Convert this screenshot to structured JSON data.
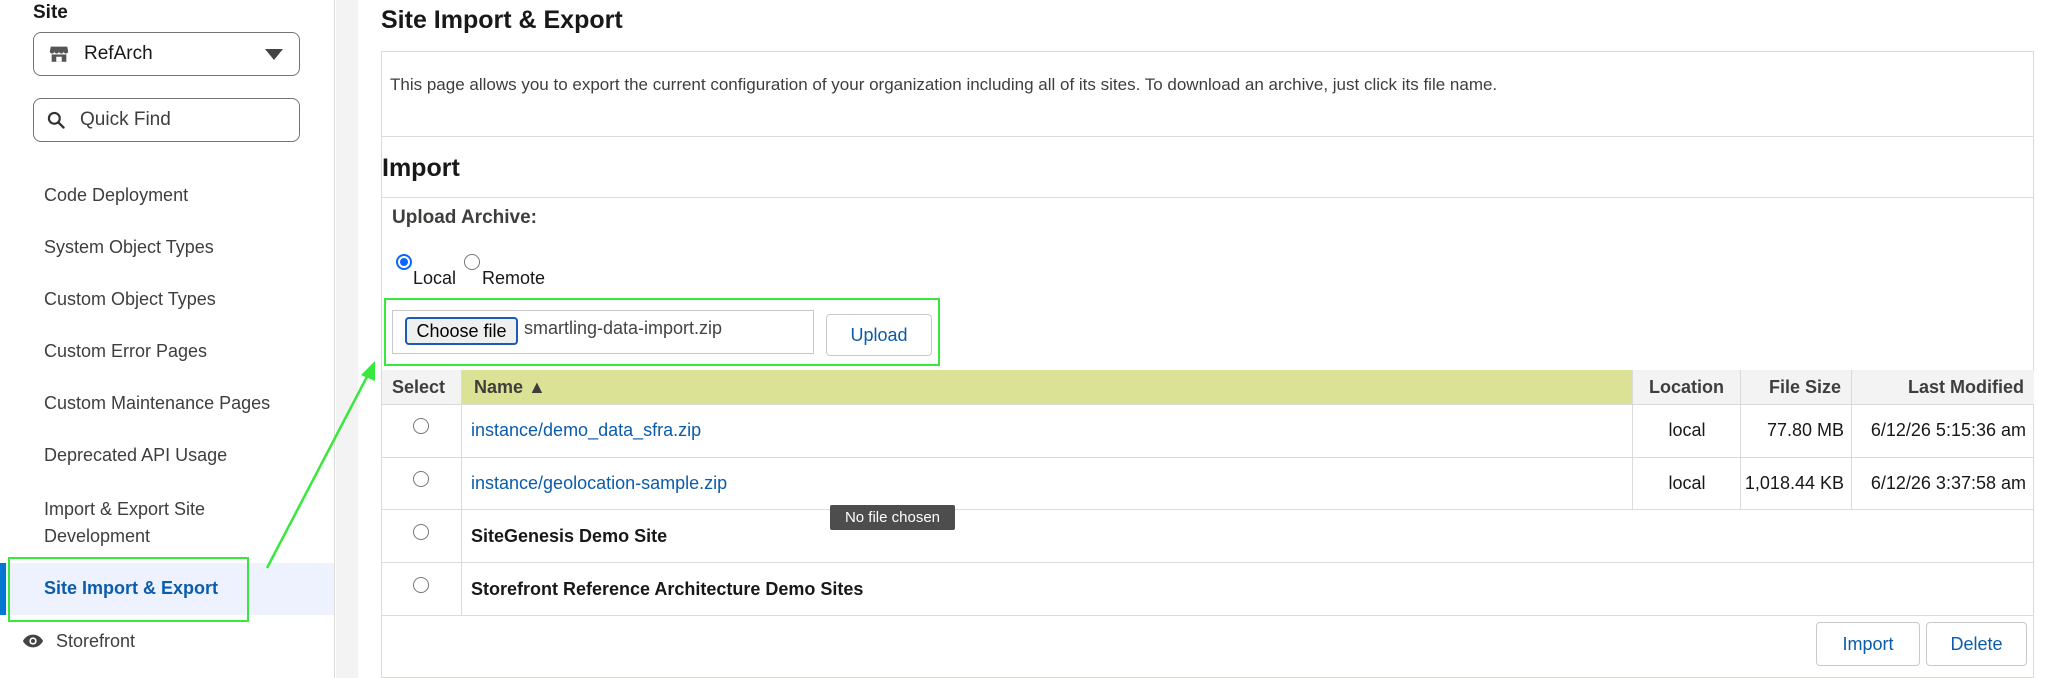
{
  "sidebar": {
    "site_label": "Site",
    "site_select": {
      "value": "RefArch",
      "icon": "store-icon"
    },
    "quick_find": {
      "placeholder": "Quick Find",
      "icon": "search-icon"
    },
    "items": [
      {
        "label": "Code Deployment"
      },
      {
        "label": "System Object Types"
      },
      {
        "label": "Custom Object Types"
      },
      {
        "label": "Custom Error Pages"
      },
      {
        "label": "Custom Maintenance Pages"
      },
      {
        "label": "Deprecated API Usage"
      },
      {
        "label": "Import & Export Site Development"
      },
      {
        "label": "Site Import & Export",
        "active": true
      }
    ],
    "storefront": {
      "label": "Storefront",
      "icon": "eye-icon"
    }
  },
  "main": {
    "title": "Site Import & Export",
    "intro": "This page allows you to export the current configuration of your organization including all of its sites. To download an archive, just click its file name.",
    "import_heading": "Import",
    "upload_label": "Upload Archive:",
    "radio_local": "Local",
    "radio_remote": "Remote",
    "choose_file": "Choose file",
    "file_name": "smartling-data-import.zip",
    "upload_button": "Upload",
    "tooltip": "No file chosen",
    "table": {
      "headers": {
        "select": "Select",
        "name": "Name ▲",
        "location": "Location",
        "size": "File Size",
        "modified": "Last Modified"
      },
      "rows": [
        {
          "name": "instance/demo_data_sfra.zip",
          "location": "local",
          "size": "77.80 MB",
          "modified": "6/12/26 5:15:36 am"
        },
        {
          "name": "instance/geolocation-sample.zip",
          "location": "local",
          "size": "1,018.44 KB",
          "modified": "6/12/26 3:37:58 am"
        },
        {
          "name": "SiteGenesis Demo Site"
        },
        {
          "name": "Storefront Reference Architecture Demo Sites"
        }
      ]
    },
    "import_button": "Import",
    "delete_button": "Delete"
  },
  "colors": {
    "highlight": "#39e83c",
    "link": "#0b5cab",
    "sorted_header": "#dce295",
    "active_nav": "#eef1fe"
  }
}
